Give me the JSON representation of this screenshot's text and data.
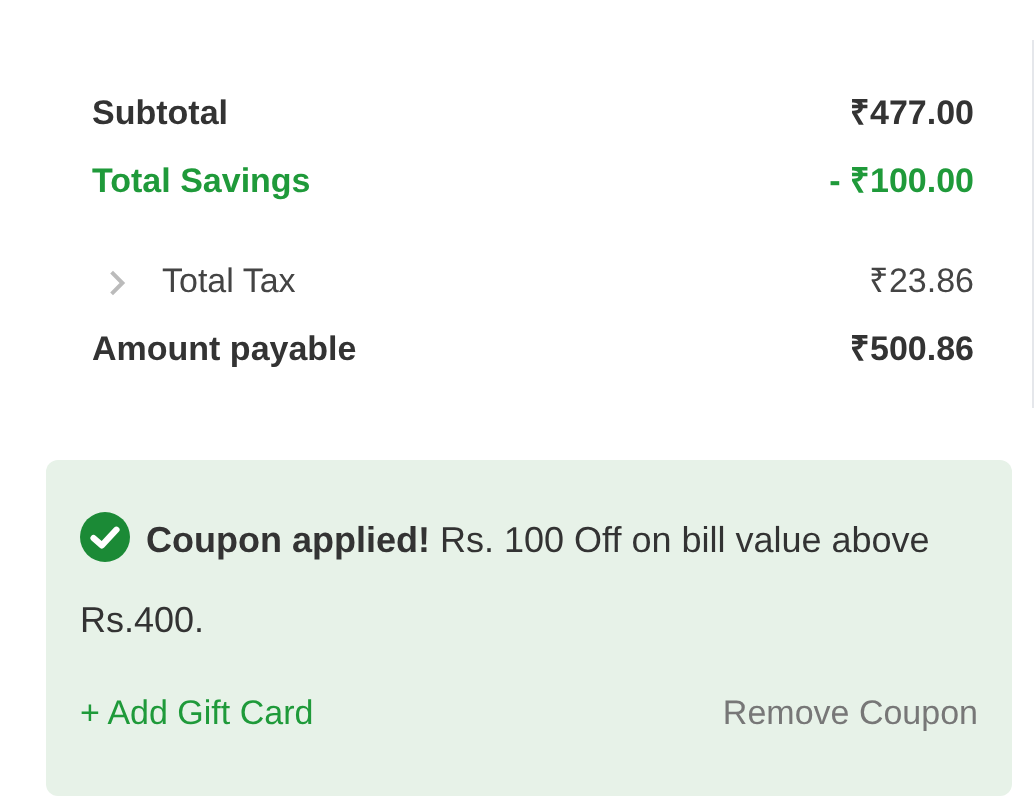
{
  "summary": {
    "rows": [
      {
        "kind": "plain",
        "label": "Subtotal",
        "value": "₹477.00"
      },
      {
        "kind": "savings",
        "label": "Total Savings",
        "value": "- ₹100.00"
      },
      {
        "kind": "expandable",
        "label": "Total Tax",
        "value": "₹23.86",
        "expanded": false
      },
      {
        "kind": "plain",
        "label": "Amount payable",
        "value": "₹500.86"
      }
    ]
  },
  "coupon": {
    "message": "**Coupon applied!** Rs. 100 Off on bill value above Rs.400.",
    "add_link": "+ Add Gift Card",
    "remove_link": "Remove Coupon"
  }
}
